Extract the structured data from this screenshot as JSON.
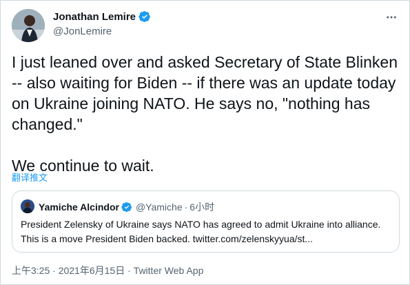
{
  "author": {
    "display_name": "Jonathan Lemire",
    "handle": "@JonLemire",
    "verified_icon": "verified-badge-icon",
    "avatar_icon": "avatar"
  },
  "tweet": {
    "text": "I just leaned over and asked Secretary of State Blinken\n-- also waiting for Biden -- if there was an update today\non Ukraine joining NATO. He says no, \"nothing has\nchanged.\"\n\nWe continue to wait.",
    "translate_label": "翻译推文"
  },
  "quote": {
    "display_name": "Yamiche Alcindor",
    "handle": "@Yamiche",
    "separator": "·",
    "time": "6小时",
    "text": "President Zelensky of Ukraine says NATO has agreed to admit Ukraine into alliance. This is a move President Biden backed. twitter.com/zelenskyyua/st..."
  },
  "footer": {
    "time": "上午3:25",
    "dot": "·",
    "date": "2021年6月15日",
    "dot2": "·",
    "source": "Twitter Web App"
  },
  "colors": {
    "accent": "#1d9bf0",
    "text": "#0f1419",
    "secondary": "#536471",
    "border": "#cfd9de"
  }
}
